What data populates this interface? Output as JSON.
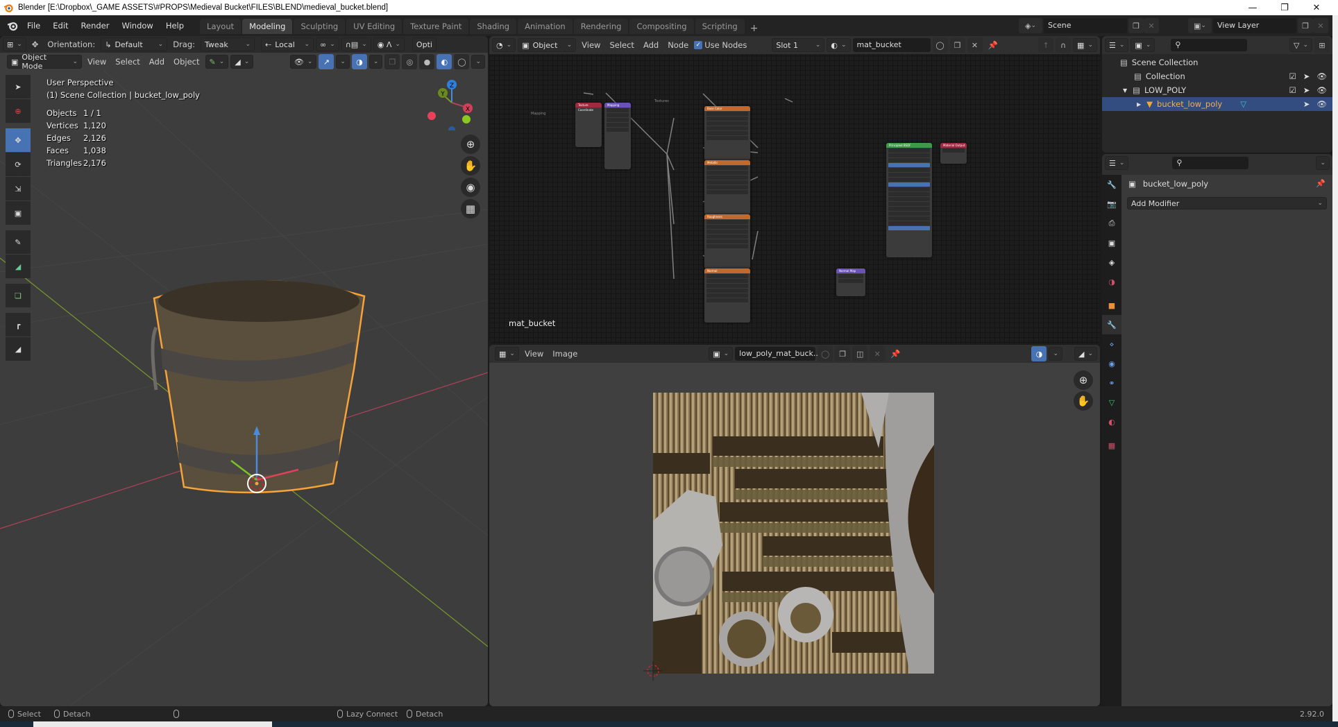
{
  "window": {
    "title": "Blender [E:\\Dropbox\\_GAME ASSETS\\#PROPS\\Medieval Bucket\\FILES\\BLEND\\medieval_bucket.blend]",
    "controls": [
      "minimize",
      "restore",
      "close"
    ]
  },
  "topbar": {
    "menus": [
      "File",
      "Edit",
      "Render",
      "Window",
      "Help"
    ],
    "workspaces": [
      {
        "label": "Layout",
        "active": false
      },
      {
        "label": "Modeling",
        "active": true
      },
      {
        "label": "Sculpting",
        "active": false
      },
      {
        "label": "UV Editing",
        "active": false
      },
      {
        "label": "Texture Paint",
        "active": false
      },
      {
        "label": "Shading",
        "active": false
      },
      {
        "label": "Animation",
        "active": false
      },
      {
        "label": "Rendering",
        "active": false
      },
      {
        "label": "Compositing",
        "active": false
      },
      {
        "label": "Scripting",
        "active": false
      }
    ],
    "add_workspace": "+",
    "scene": "Scene",
    "view_layer": "View Layer"
  },
  "viewport3d": {
    "tool_header": {
      "orientation_label": "Orientation:",
      "orientation_value": "Default",
      "drag_label": "Drag:",
      "drag_value": "Tweak",
      "pivot_value": "Local",
      "options_label": "Opti"
    },
    "header": {
      "mode": "Object Mode",
      "menus": [
        "View",
        "Select",
        "Add",
        "Object"
      ]
    },
    "overlay": {
      "view_name": "User Perspective",
      "collection_info": "(1) Scene Collection | bucket_low_poly"
    },
    "stats": [
      {
        "label": "Objects",
        "value": "1 / 1"
      },
      {
        "label": "Vertices",
        "value": "1,120"
      },
      {
        "label": "Edges",
        "value": "2,126"
      },
      {
        "label": "Faces",
        "value": "1,038"
      },
      {
        "label": "Triangles",
        "value": "2,176"
      }
    ],
    "gizmo_axes": [
      "X",
      "Y",
      "Z"
    ],
    "tools": [
      "select-box",
      "cursor",
      "move",
      "rotate",
      "scale",
      "transform",
      "annotate",
      "measure",
      "add-cube",
      "extrude",
      "inset"
    ],
    "active_tool": "move"
  },
  "node_editor": {
    "header": {
      "object_type": "Object",
      "menus": [
        "View",
        "Select",
        "Add",
        "Node"
      ],
      "use_nodes_label": "Use Nodes",
      "use_nodes_checked": true,
      "slot": "Slot 1",
      "material": "mat_bucket"
    },
    "material_label": "mat_bucket",
    "frames": [
      "Mapping",
      "Textures"
    ],
    "nodes": [
      {
        "name": "Texture Coordinate",
        "color": "#a4283e"
      },
      {
        "name": "Mapping",
        "color": "#6a52b8"
      },
      {
        "name": "Base Color",
        "color": "#c06a30"
      },
      {
        "name": "Metallic",
        "color": "#c06a30"
      },
      {
        "name": "Roughness",
        "color": "#c06a30"
      },
      {
        "name": "Normal",
        "color": "#c06a30"
      },
      {
        "name": "Normal Map",
        "color": "#6a52b8"
      },
      {
        "name": "Principled BSDF",
        "color": "#3e9a48"
      },
      {
        "name": "Material Output",
        "color": "#a4283e"
      }
    ]
  },
  "image_editor": {
    "header": {
      "menus": [
        "View",
        "Image"
      ],
      "image_name": "low_poly_mat_buck..."
    }
  },
  "outliner": {
    "items": [
      {
        "label": "Scene Collection",
        "level": 0
      },
      {
        "label": "Collection",
        "level": 1,
        "checked": true
      },
      {
        "label": "LOW_POLY",
        "level": 1,
        "checked": true,
        "expanded": true
      },
      {
        "label": "bucket_low_poly",
        "level": 2,
        "selected": true
      }
    ]
  },
  "properties": {
    "object_name": "bucket_low_poly",
    "add_modifier_label": "Add Modifier",
    "active_tab": "modifiers",
    "tabs": [
      "tool",
      "render",
      "output",
      "view-layer",
      "scene",
      "world",
      "object",
      "modifiers",
      "particles",
      "physics",
      "constraints",
      "data",
      "material",
      "texture"
    ]
  },
  "statusbar": {
    "left": [
      {
        "icon": "mouse-left",
        "label": "Select"
      },
      {
        "icon": "mouse-right",
        "label": "Detach"
      }
    ],
    "middle_icon": "mouse-middle",
    "center": [
      {
        "icon": "mouse-left",
        "label": "Lazy Connect"
      },
      {
        "icon": "mouse-right",
        "label": "Detach"
      }
    ],
    "version": "2.92.0"
  },
  "colors": {
    "accent_blue": "#4772b3",
    "selection_orange": "#f5a33a",
    "selected_row": "#334d80"
  }
}
